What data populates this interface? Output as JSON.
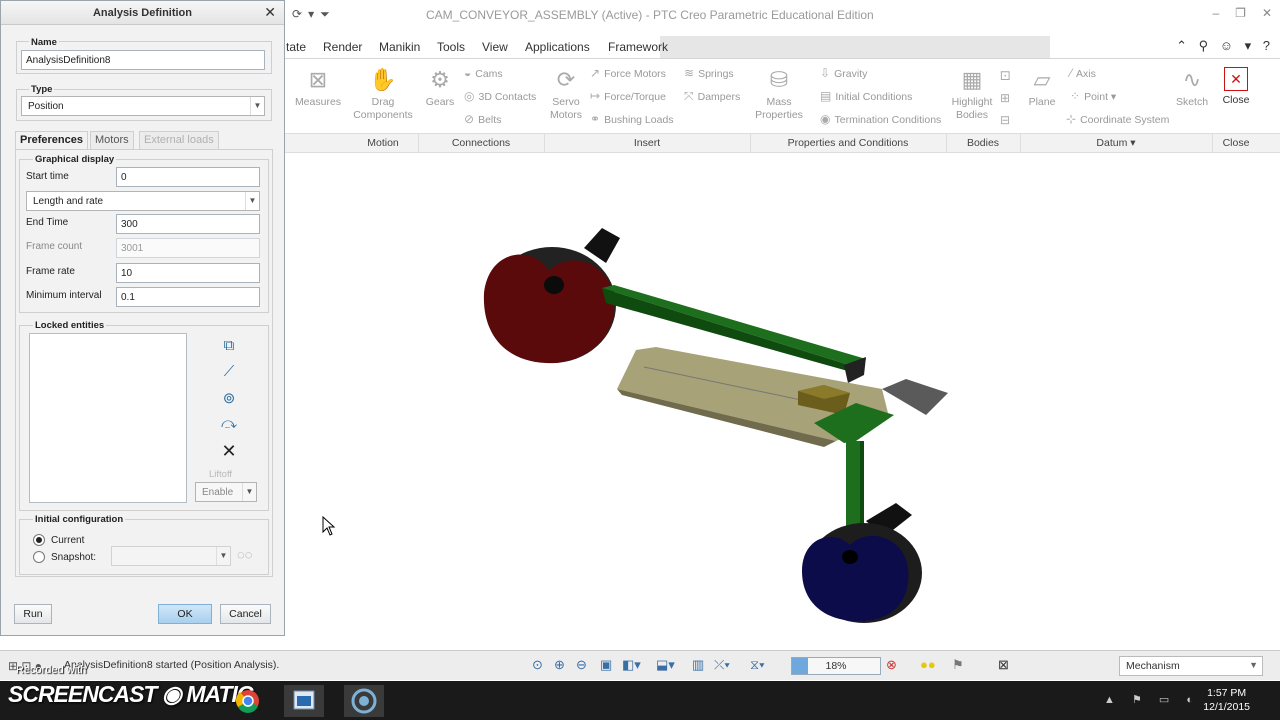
{
  "window": {
    "title": "CAM_CONVEYOR_ASSEMBLY (Active) - PTC Creo Parametric Educational Edition"
  },
  "ribbon": {
    "tabs": [
      "tate",
      "Render",
      "Manikin",
      "Tools",
      "View",
      "Applications",
      "Framework"
    ],
    "items": {
      "measures": "Measures",
      "drag_components": "Drag Components",
      "gears": "Gears",
      "cams": "Cams",
      "contacts_3d": "3D Contacts",
      "belts": "Belts",
      "servo_motors": "Servo Motors",
      "force_motors": "Force Motors",
      "force_torque": "Force/Torque",
      "bushing_loads": "Bushing Loads",
      "springs": "Springs",
      "dampers": "Dampers",
      "mass_properties": "Mass Properties",
      "gravity": "Gravity",
      "initial_conditions": "Initial Conditions",
      "termination_conditions": "Termination Conditions",
      "highlight_bodies": "Highlight Bodies",
      "plane": "Plane",
      "axis": "Axis",
      "point": "Point",
      "coordinate_system": "Coordinate System",
      "sketch": "Sketch",
      "close": "Close"
    },
    "groups": {
      "motion": "Motion",
      "connections": "Connections",
      "insert": "Insert",
      "properties": "Properties and Conditions",
      "bodies": "Bodies",
      "datum": "Datum",
      "close": "Close"
    }
  },
  "dialog": {
    "title": "Analysis Definition",
    "name_label": "Name",
    "name_value": "AnalysisDefinition8",
    "type_label": "Type",
    "type_value": "Position",
    "tabs": {
      "preferences": "Preferences",
      "motors": "Motors",
      "external_loads": "External loads"
    },
    "graphical_display": {
      "legend": "Graphical display",
      "start_time_label": "Start time",
      "start_time": "0",
      "mode": "Length and rate",
      "end_time_label": "End Time",
      "end_time": "300",
      "frame_count_label": "Frame count",
      "frame_count": "3001",
      "frame_rate_label": "Frame rate",
      "frame_rate": "10",
      "min_interval_label": "Minimum interval",
      "min_interval": "0.1"
    },
    "locked_entities": {
      "legend": "Locked entities",
      "liftoff": "Liftoff",
      "enable": "Enable"
    },
    "initial_configuration": {
      "legend": "Initial configuration",
      "current": "Current",
      "snapshot": "Snapshot:"
    },
    "run": "Run",
    "ok": "OK",
    "cancel": "Cancel"
  },
  "status": {
    "message": "AnalysisDefinition8 started (Position Analysis).",
    "zoom": "18%",
    "zoom_fraction": 0.18,
    "mode": "Mechanism"
  },
  "taskbar": {
    "brand": "SCREENCAST",
    "brand2": "MATIC",
    "recorded_with": "Recorded with",
    "time": "1:57 PM",
    "date": "12/1/2015"
  },
  "colors": {
    "crank_top": "#5a0a0a",
    "crank_bottom": "#0c0c4a",
    "link": "#1d6e1d",
    "slider_base": "#a7a278",
    "block": "#5a5a5a",
    "accent": "#6fa8dc"
  }
}
